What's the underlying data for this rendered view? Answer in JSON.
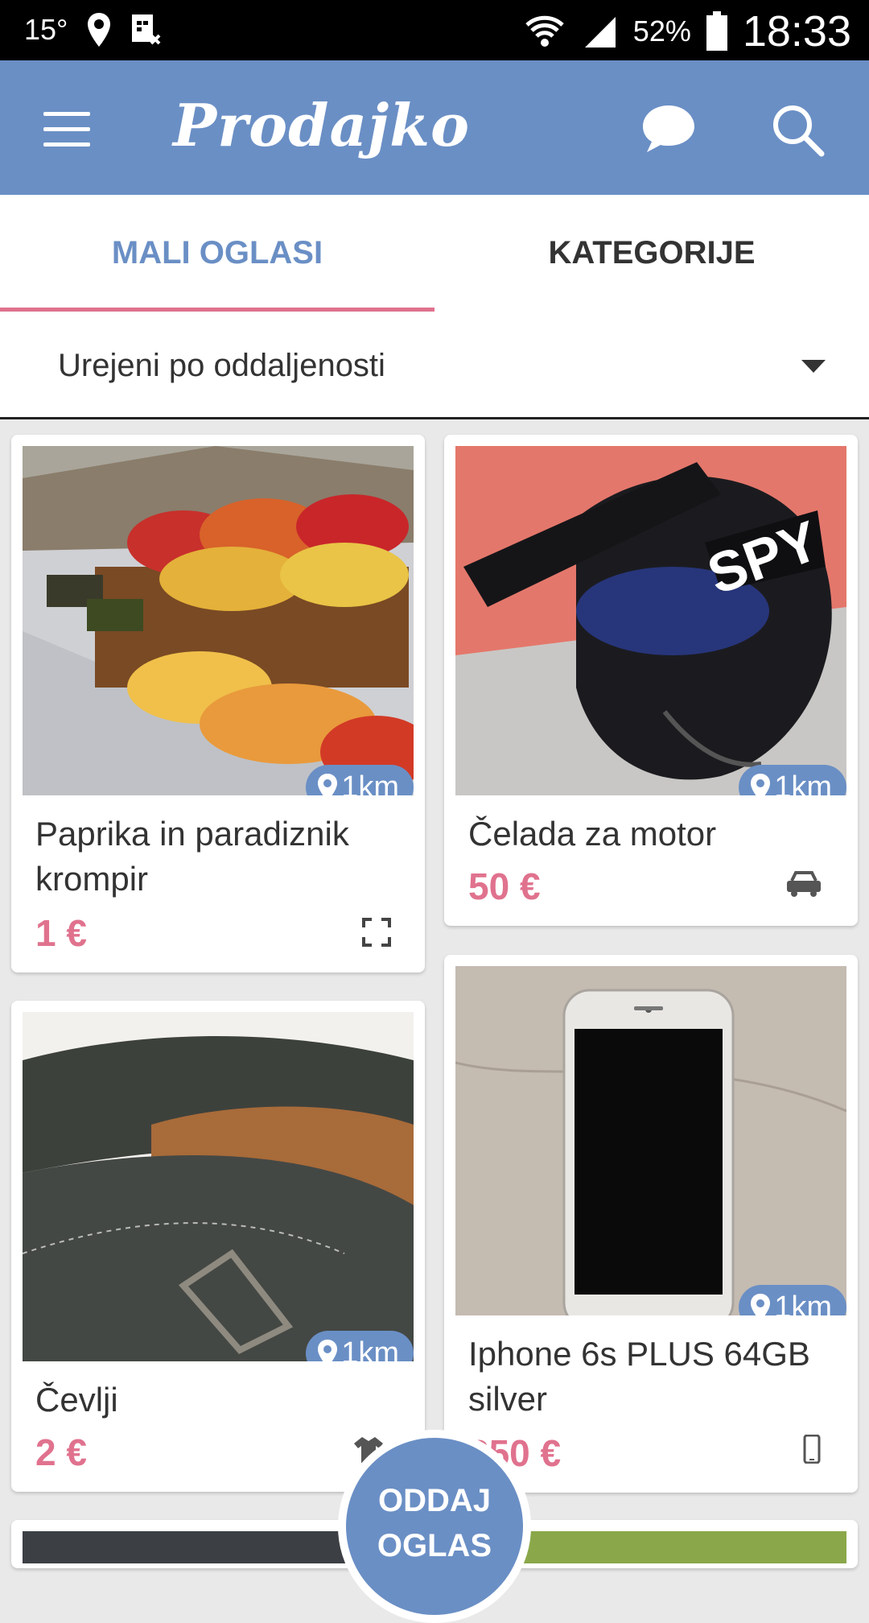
{
  "status_bar": {
    "temperature": "15°",
    "battery": "52%",
    "time": "18:33"
  },
  "app": {
    "title": "Prodajko"
  },
  "tabs": [
    {
      "label": "MALI OGLASI"
    },
    {
      "label": "KATEGORIJE"
    }
  ],
  "sort": {
    "label": "Urejeni po oddaljenosti"
  },
  "listings": [
    {
      "title": "Paprika in paradiznik krompir",
      "price": "1 €",
      "distance": "1km",
      "category_icon": "fullscreen-icon"
    },
    {
      "title": "Čelada za motor",
      "price": "50 €",
      "distance": "1km",
      "category_icon": "car-icon"
    },
    {
      "title": "Čevlji",
      "price": "2 €",
      "distance": "1km",
      "category_icon": "clothing-icon"
    },
    {
      "title": "Iphone 6s PLUS 64GB silver",
      "price": "350 €",
      "distance": "1km",
      "category_icon": "phone-icon"
    }
  ],
  "fab": {
    "line1": "ODDAJ",
    "line2": "OGLAS"
  },
  "colors": {
    "primary": "#6a8fc5",
    "accent": "#e0728e"
  }
}
